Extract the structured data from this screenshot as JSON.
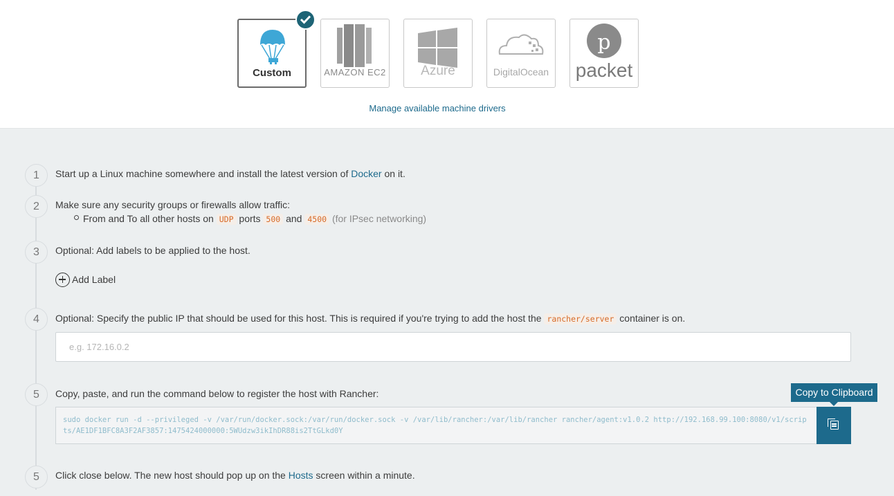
{
  "drivers": [
    {
      "name": "Custom",
      "selected": true
    },
    {
      "name": "AMAZON EC2",
      "selected": false
    },
    {
      "name": "Azure",
      "selected": false
    },
    {
      "name": "DigitalOcean",
      "selected": false
    },
    {
      "name": "packet",
      "selected": false
    }
  ],
  "manage_link": "Manage available machine drivers",
  "steps": {
    "s1": {
      "num": "1",
      "pre": "Start up a Linux machine somewhere and install the latest version of",
      "link": "Docker",
      "post": "on it."
    },
    "s2": {
      "num": "2",
      "text": "Make sure any security groups or firewalls allow traffic:",
      "bullet_pre": "From and To all other hosts on",
      "proto": "UDP",
      "ports_word": "ports",
      "port1": "500",
      "and_word": "and",
      "port2": "4500",
      "note": "(for IPsec networking)"
    },
    "s3": {
      "num": "3",
      "text": "Optional: Add labels to be applied to the host.",
      "add_label": "Add Label"
    },
    "s4": {
      "num": "4",
      "pre": "Optional: Specify the public IP that should be used for this host. This is required if you're trying to add the host the",
      "code": "rancher/server",
      "post": "container is on.",
      "placeholder": "e.g. 172.16.0.2"
    },
    "s5": {
      "num": "5",
      "text": "Copy, paste, and run the command below to register the host with Rancher:",
      "command": "sudo docker run -d --privileged -v /var/run/docker.sock:/var/run/docker.sock -v /var/lib/rancher:/var/lib/rancher rancher/agent:v1.0.2 http://192.168.99.100:8080/v1/scripts/AE1DF1BFC8A3F2AF3857:1475424000000:5WUdzw3ikIhDR88is2TtGLkd0Y",
      "tooltip": "Copy to Clipboard"
    },
    "s6": {
      "num": "5",
      "pre": "Click close below. The new host should pop up on the",
      "link": "Hosts",
      "post": "screen within a minute."
    }
  },
  "colors": {
    "accent": "#1d6a8c",
    "check": "#1e6476",
    "code": "#d76a27"
  }
}
